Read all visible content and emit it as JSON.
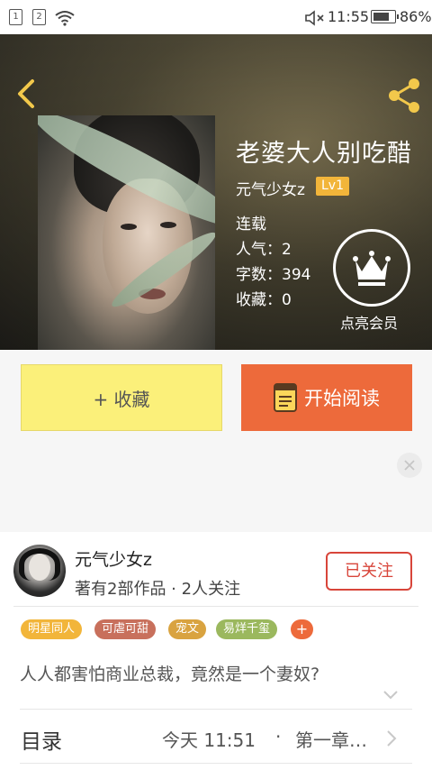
{
  "status_bar": {
    "sim1": "1",
    "sim2": "2",
    "time": "11:55",
    "battery": "86%",
    "battery_level": 0.86
  },
  "book": {
    "title": "老婆大人别吃醋",
    "author": "元气少女z",
    "level": "Lv1",
    "status": "连载",
    "popularity": "人气：2",
    "word_count": "字数：394",
    "favorites": "收藏：0",
    "vip_label": "点亮会员"
  },
  "actions": {
    "collect": "+ 收藏",
    "read": "开始阅读"
  },
  "author_card": {
    "name": "元气少女z",
    "stats": "著有2部作品 · 2人关注",
    "follow_label": "已关注"
  },
  "tags": [
    {
      "label": "明星同人",
      "color": "#f2b53a"
    },
    {
      "label": "可虐可甜",
      "color": "#c8705c"
    },
    {
      "label": "宠文",
      "color": "#d9a340"
    },
    {
      "label": "易烊千玺",
      "color": "#9bb85e"
    }
  ],
  "tag_add": "+",
  "description": "人人都害怕商业总裁，竟然是一个妻奴?",
  "toc": {
    "label": "目录",
    "time": "今天 11:51",
    "separator": "·",
    "chapter": "第一章…"
  },
  "colors": {
    "accent_orange": "#ed6a3b",
    "collect_yellow": "#fbf07a",
    "follow_red": "#d8453a",
    "badge_gold": "#f2b53a"
  }
}
